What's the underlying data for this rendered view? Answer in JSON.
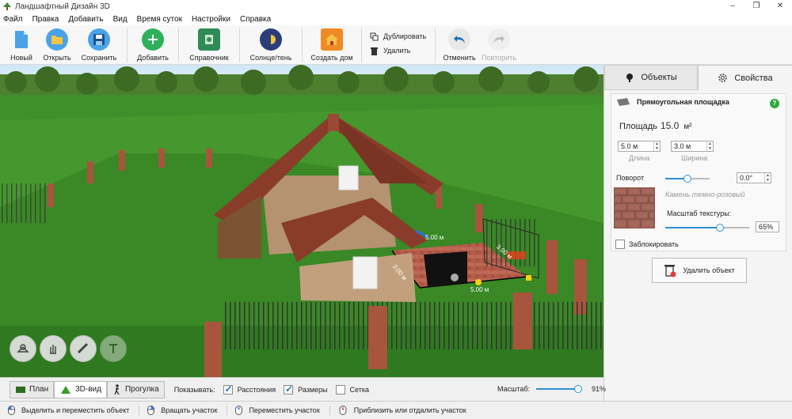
{
  "window": {
    "title": "Ландшафтный Дизайн 3D",
    "controls": [
      "–",
      "❐",
      "✕"
    ]
  },
  "menu": [
    "Файл",
    "Правка",
    "Добавить",
    "Вид",
    "Время суток",
    "Настройки",
    "Справка"
  ],
  "toolbar": {
    "new": "Новый",
    "open": "Открыть",
    "save": "Сохранить",
    "add": "Добавить",
    "catalog": "Справочник",
    "sun": "Солнце/тень",
    "house": "Создать дом",
    "duplicate": "Дублировать",
    "delete": "Удалить",
    "undo": "Отменить",
    "redo": "Повторить"
  },
  "scene": {
    "dim_left": "3.00 м",
    "dim_top": "5.00 м",
    "dim_bottom": "5.00 м",
    "dim_right": "3.00 м"
  },
  "tabs": {
    "objects": "Объекты",
    "properties": "Свойства"
  },
  "props": {
    "object_name": "Прямоугольная площадка",
    "help": "?",
    "area_label": "Площадь",
    "area_value": "15.0",
    "area_unit": "м²",
    "length_value": "5.0 м",
    "length_caption": "Длина",
    "width_value": "3.0 м",
    "width_caption": "Ширина",
    "rotation_label": "Поворот",
    "rotation_value": "0.0°",
    "rotation_fraction": 0.5,
    "texture_name": "Камень темно-розовый",
    "texture_scale_label": "Масштаб текстуры:",
    "texture_scale_value": "65%",
    "texture_scale_fraction": 0.65,
    "lock_label": "Заблокировать",
    "lock_checked": false,
    "delete_button": "Удалить объект"
  },
  "bottom": {
    "view_plan": "План",
    "view_3d": "3D-вид",
    "view_walk": "Прогулка",
    "show_label": "Показывать:",
    "distances": "Расстояния",
    "distances_checked": true,
    "sizes": "Размеры",
    "sizes_checked": true,
    "grid": "Сетка",
    "grid_checked": false,
    "zoom_label": "Масштаб:",
    "zoom_value": "91%",
    "zoom_fraction": 0.91
  },
  "status": {
    "select_move": "Выделить и переместить объект",
    "rotate": "Вращать участок",
    "move": "Переместить участок",
    "zoom": "Приблизить или отдалить участок"
  },
  "colors": {
    "accent": "#2b8fd6",
    "grass": "#3f8f2a",
    "roof": "#8a3c2a",
    "brick": "#a8553d",
    "paving": "#b45c4a"
  }
}
